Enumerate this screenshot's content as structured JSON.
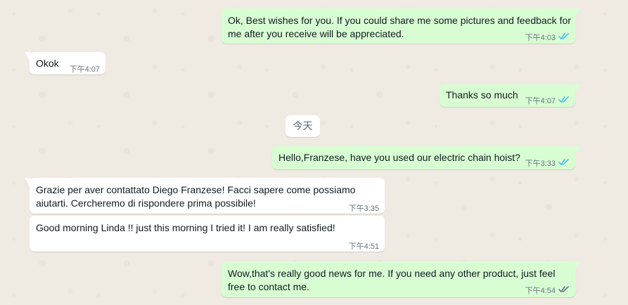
{
  "messages": [
    {
      "id": "m1",
      "direction": "outgoing",
      "text_line1": "Ok, Best wishes for you. If you could share me some pictures and feedback for",
      "text_line2": "me after you receive will be appreciated.",
      "time": "下午4:03",
      "status": "read",
      "status_color": "#53bdeb"
    },
    {
      "id": "m2",
      "direction": "incoming",
      "text": "Okok",
      "time": "下午4:07"
    },
    {
      "id": "m3",
      "direction": "outgoing",
      "text": "Thanks so much",
      "time": "下午4:07",
      "status": "read",
      "status_color": "#53bdeb"
    },
    {
      "id": "m4",
      "direction": "outgoing",
      "text": "Hello,Franzese, have you used our electric chain hoist?",
      "time": "下午3:33",
      "status": "read",
      "status_color": "#53bdeb"
    },
    {
      "id": "m5",
      "direction": "incoming",
      "text_line1": "Grazie per aver contattato Diego Franzese! Facci sapere come possiamo",
      "text_line2": "aiutarti. Cercheremo di rispondere prima possibile!",
      "time": "下午3:35"
    },
    {
      "id": "m6",
      "direction": "incoming",
      "text": "Good morning Linda !! just this morning I tried it! I am really satisfied!",
      "time": "下午4:51"
    },
    {
      "id": "m7",
      "direction": "outgoing",
      "text_line1": "Wow,that's really good news for me. If you need any other product, just feel",
      "text_line2": "free to contact me.",
      "time": "下午4:54",
      "status": "delivered",
      "status_color": "#667781"
    }
  ],
  "date_divider": "今天",
  "colors": {
    "background": "#efeae2",
    "outgoing_bubble": "#d9fdd3",
    "incoming_bubble": "#ffffff",
    "timestamp": "#667781",
    "read_ticks": "#53bdeb",
    "delivered_ticks": "#8696a0"
  },
  "icons": {
    "read_status": "double-check-icon",
    "delivered_status": "double-check-icon"
  }
}
